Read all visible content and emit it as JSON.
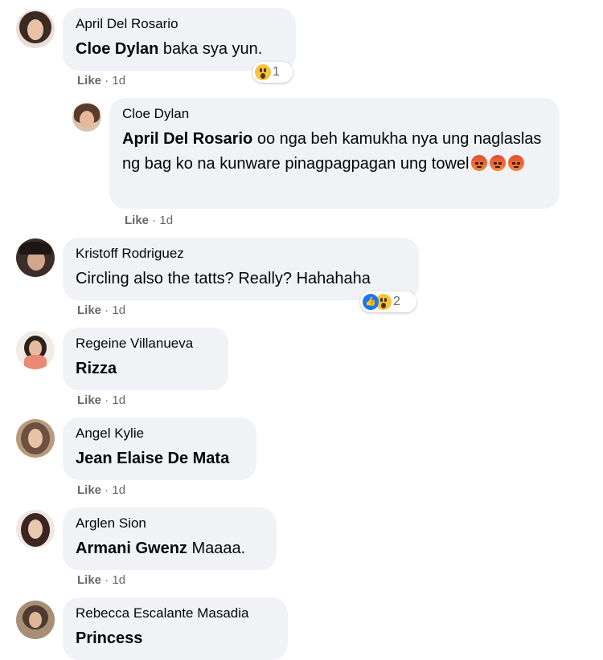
{
  "comments": [
    {
      "author": "April Del Rosario",
      "mention": "Cloe Dylan",
      "text": " baka sya yun.",
      "like": "Like",
      "time": "1d",
      "reaction_count": "1"
    },
    {
      "author": "Cloe Dylan",
      "mention": "April Del Rosario",
      "text": " oo nga beh kamukha nya ung naglaslas ng bag ko na kunware pinagpagpagan ung towel",
      "like": "Like",
      "time": "1d"
    },
    {
      "author": "Kristoff Rodriguez",
      "mention": "",
      "text": "Circling also the tatts? Really? Hahahaha",
      "like": "Like",
      "time": "1d",
      "reaction_count": "2"
    },
    {
      "author": "Regeine Villanueva",
      "mention": "Rizza",
      "text": "",
      "like": "Like",
      "time": "1d"
    },
    {
      "author": "Angel Kylie",
      "mention": "Jean Elaise De Mata",
      "text": "",
      "like": "Like",
      "time": "1d"
    },
    {
      "author": "Arglen Sion",
      "mention": "Armani Gwenz",
      "text": " Maaaa.",
      "like": "Like",
      "time": "1d"
    },
    {
      "author": "Rebecca Escalante Masadia",
      "mention": "Princess",
      "text": ""
    }
  ],
  "separator": " · ",
  "icons": {
    "wow": "wow-reaction-icon",
    "like": "like-reaction-icon",
    "angry": "angry-emoji-icon"
  },
  "colors": {
    "bubble": "#f0f2f5",
    "meta": "#65676b",
    "like_blue": "#1877f2"
  }
}
